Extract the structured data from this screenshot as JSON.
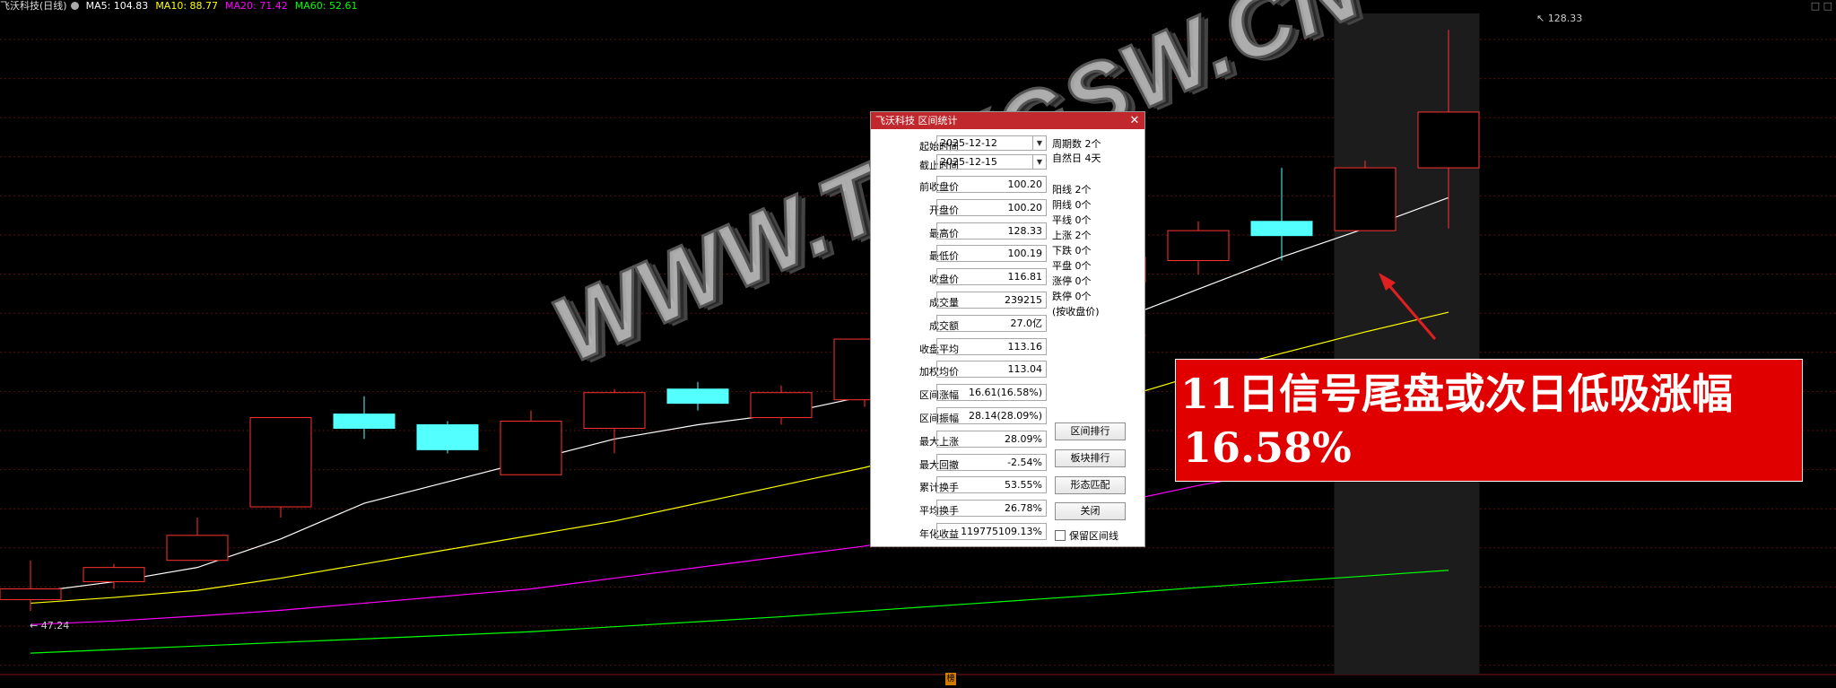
{
  "header": {
    "title": "飞沃科技(日线)",
    "ma5": "MA5: 104.83",
    "ma10": "MA10: 88.77",
    "ma20": "MA20: 71.42",
    "ma60": "MA60: 52.61",
    "top_right_icons": "□ □"
  },
  "colors": {
    "up": "#ff3232",
    "down": "#54ffff",
    "ma5": "#ffffff",
    "ma10": "#ffff00",
    "ma20": "#ff00ff",
    "ma60": "#00ff00",
    "highlight": "#1c1c1c",
    "banner": "#e00000",
    "title_bar": "#c0282d"
  },
  "price_labels": {
    "high": "128.33",
    "low": "47.24"
  },
  "dialog": {
    "title": "飞沃科技 区间统计",
    "close": "✕",
    "start_label": "起始时间",
    "start_value": "2025-12-12",
    "end_label": "截止时间",
    "end_value": "2025-12-15",
    "rows": [
      {
        "label": "前收盘价",
        "value": "100.20"
      },
      {
        "label": "开盘价",
        "value": "100.20"
      },
      {
        "label": "最高价",
        "value": "128.33"
      },
      {
        "label": "最低价",
        "value": "100.19"
      },
      {
        "label": "收盘价",
        "value": "116.81"
      },
      {
        "label": "成交量",
        "value": "239215"
      },
      {
        "label": "成交额",
        "value": "27.0亿"
      },
      {
        "label": "收盘平均",
        "value": "113.16"
      },
      {
        "label": "加权均价",
        "value": "113.04"
      },
      {
        "label": "区间涨幅",
        "value": "16.61(16.58%)"
      },
      {
        "label": "区间振幅",
        "value": "28.14(28.09%)"
      },
      {
        "label": "最大上涨",
        "value": "28.09%"
      },
      {
        "label": "最大回撤",
        "value": "-2.54%"
      },
      {
        "label": "累计换手",
        "value": "53.55%"
      },
      {
        "label": "平均换手",
        "value": "26.78%"
      },
      {
        "label": "年化收益",
        "value": "119775109.13%"
      }
    ],
    "period_count": "周期数 2个",
    "natural_days": "自然日 4天",
    "right_stats": [
      "阳线 2个",
      "阴线 0个",
      "平线 0个",
      "上涨 2个",
      "下跌 0个",
      "平盘 0个",
      "涨停 0个",
      "跌停 0个",
      "(按收盘价)"
    ],
    "buttons": [
      "区间排行",
      "板块排行",
      "形态匹配",
      "关闭"
    ],
    "keep_checkbox": "保留区间线"
  },
  "watermark": "WWW.TDXGSW.CN",
  "banner": {
    "line1": "11日信号尾盘或次日低吸涨幅",
    "line2": "16.58%"
  },
  "bottom_tag": "榜",
  "chart_data": {
    "type": "candlestick",
    "title": "飞沃科技(日线)",
    "candles": [
      {
        "open": 48.5,
        "high": 54.0,
        "low": 46.9,
        "close": 50.0
      },
      {
        "open": 51.0,
        "high": 53.5,
        "low": 50.0,
        "close": 53.0
      },
      {
        "open": 54.0,
        "high": 60.0,
        "low": 54.0,
        "close": 57.5
      },
      {
        "open": 61.5,
        "high": 74.0,
        "low": 60.0,
        "close": 74.0
      },
      {
        "open": 74.5,
        "high": 77.0,
        "low": 71.0,
        "close": 72.5
      },
      {
        "open": 73.0,
        "high": 73.5,
        "low": 69.0,
        "close": 69.5
      },
      {
        "open": 66.0,
        "high": 75.0,
        "low": 66.0,
        "close": 73.5
      },
      {
        "open": 72.5,
        "high": 78.0,
        "low": 69.0,
        "close": 77.5
      },
      {
        "open": 78.0,
        "high": 79.0,
        "low": 75.0,
        "close": 76.0
      },
      {
        "open": 74.0,
        "high": 78.5,
        "low": 73.0,
        "close": 77.5
      },
      {
        "open": 76.5,
        "high": 85.0,
        "low": 75.5,
        "close": 85.0
      },
      {
        "open": 87.0,
        "high": 96.0,
        "low": 85.0,
        "close": 95.0
      },
      {
        "open": 95.0,
        "high": 98.0,
        "low": 90.0,
        "close": 91.5
      },
      {
        "open": 93.0,
        "high": 100.5,
        "low": 91.0,
        "close": 96.5
      },
      {
        "open": 96.0,
        "high": 101.5,
        "low": 94.0,
        "close": 100.2
      },
      {
        "open": 101.5,
        "high": 109.0,
        "low": 96.0,
        "close": 99.5
      },
      {
        "open": 100.2,
        "high": 110.0,
        "low": 100.19,
        "close": 109.0
      },
      {
        "open": 109.0,
        "high": 128.33,
        "low": 100.5,
        "close": 116.81
      }
    ],
    "ma5": [
      49.5,
      51.0,
      53.0,
      57.0,
      62.0,
      65.0,
      68.0,
      71.0,
      73.0,
      74.5,
      77.0,
      80.0,
      84.0,
      87.5,
      92.0,
      96.5,
      100.5,
      104.83
    ],
    "ma10": [
      48.0,
      48.8,
      49.8,
      51.5,
      53.5,
      55.5,
      57.5,
      59.5,
      62.0,
      64.5,
      67.0,
      70.0,
      73.0,
      76.5,
      80.0,
      83.0,
      86.0,
      88.77
    ],
    "ma20": [
      45.0,
      45.5,
      46.2,
      47.0,
      48.0,
      49.0,
      50.0,
      51.5,
      53.0,
      54.5,
      56.0,
      58.0,
      60.0,
      62.0,
      64.5,
      66.5,
      69.0,
      71.42
    ],
    "ma60": [
      41.0,
      41.5,
      42.0,
      42.5,
      43.0,
      43.5,
      44.0,
      44.7,
      45.4,
      46.1,
      46.9,
      47.7,
      48.5,
      49.3,
      50.2,
      51.0,
      51.8,
      52.61
    ],
    "highlight_range": [
      16,
      17
    ],
    "ylim": [
      38,
      130
    ]
  }
}
